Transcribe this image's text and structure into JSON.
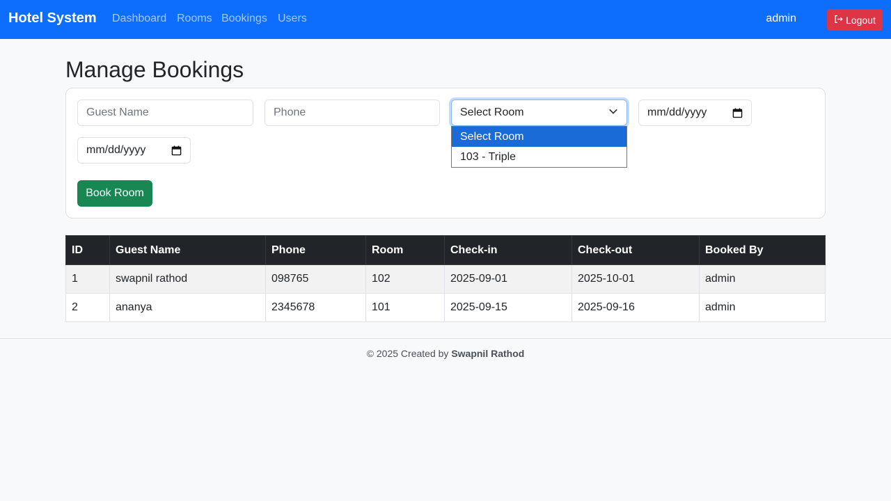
{
  "nav": {
    "brand": "Hotel System",
    "links": [
      "Dashboard",
      "Rooms",
      "Bookings",
      "Users"
    ],
    "user": "admin",
    "logout_label": "Logout"
  },
  "colors": {
    "primary": "#0d6efd",
    "danger": "#dc3545",
    "success": "#198754",
    "dark": "#212529"
  },
  "page": {
    "title": "Manage Bookings"
  },
  "form": {
    "guest_name_placeholder": "Guest Name",
    "phone_placeholder": "Phone",
    "room_select_value": "Select Room",
    "room_options": [
      "Select Room",
      "103 - Triple"
    ],
    "checkin_placeholder": "mm/dd/yyyy",
    "checkout_placeholder": "mm/dd/yyyy",
    "submit_label": "Book Room"
  },
  "table": {
    "headers": [
      "ID",
      "Guest Name",
      "Phone",
      "Room",
      "Check-in",
      "Check-out",
      "Booked By"
    ],
    "rows": [
      [
        "1",
        "swapnil rathod",
        "098765",
        "102",
        "2025-09-01",
        "2025-10-01",
        "admin"
      ],
      [
        "2",
        "ananya",
        "2345678",
        "101",
        "2025-09-15",
        "2025-09-16",
        "admin"
      ]
    ]
  },
  "footer": {
    "prefix": "© 2025 Created by",
    "author": "Swapnil Rathod"
  }
}
